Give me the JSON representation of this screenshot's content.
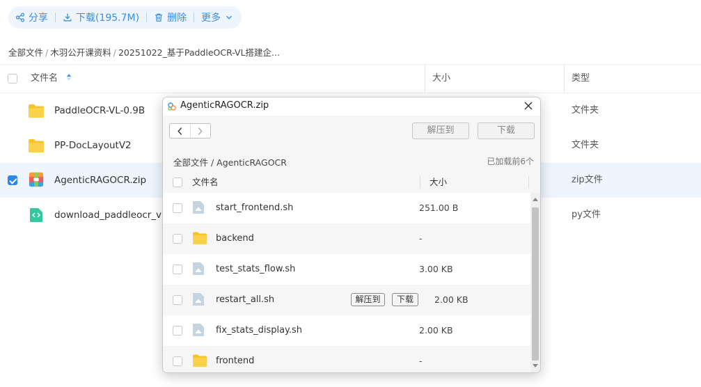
{
  "toolbar": {
    "share_label": "分享",
    "download_label": "下载(195.7M)",
    "delete_label": "删除",
    "more_label": "更多"
  },
  "breadcrumb": {
    "items": [
      "全部文件",
      "木羽公开课资料",
      "20251022_基于PaddleOCR-VL搭建企..."
    ],
    "separator": "/"
  },
  "table": {
    "columns": {
      "name": "文件名",
      "size": "大小",
      "type": "类型"
    },
    "rows": [
      {
        "name": "PaddleOCR-VL-0.9B",
        "type": "文件夹",
        "icon": "folder-icon",
        "selected": false
      },
      {
        "name": "PP-DocLayoutV2",
        "type": "文件夹",
        "icon": "folder-icon",
        "selected": false
      },
      {
        "name": "AgenticRAGOCR.zip",
        "type": "zip文件",
        "icon": "zip-archive-icon",
        "selected": true
      },
      {
        "name": "download_paddleocr_vl.py",
        "type": "py文件",
        "icon": "python-file-icon",
        "selected": false
      }
    ]
  },
  "modal": {
    "title": "AgenticRAGOCR.zip",
    "extract_label": "解压到",
    "download_label": "下载",
    "path": "全部文件 / AgenticRAGOCR",
    "loaded_count": "已加载前6个",
    "col_name": "文件名",
    "col_size": "大小",
    "row_extract_label": "解压到",
    "row_download_label": "下载",
    "files": [
      {
        "name": "start_frontend.sh",
        "size": "251.00 B",
        "kind": "file"
      },
      {
        "name": "backend",
        "size": "-",
        "kind": "folder"
      },
      {
        "name": "test_stats_flow.sh",
        "size": "3.00 KB",
        "kind": "file"
      },
      {
        "name": "restart_all.sh",
        "size": "2.00 KB",
        "kind": "file",
        "hovered": true
      },
      {
        "name": "fix_stats_display.sh",
        "size": "2.00 KB",
        "kind": "file"
      },
      {
        "name": "frontend",
        "size": "-",
        "kind": "folder"
      }
    ]
  },
  "colors": {
    "accent": "#3a8ee6",
    "selected_row": "#eef5fd",
    "folder": "#f7c325"
  }
}
